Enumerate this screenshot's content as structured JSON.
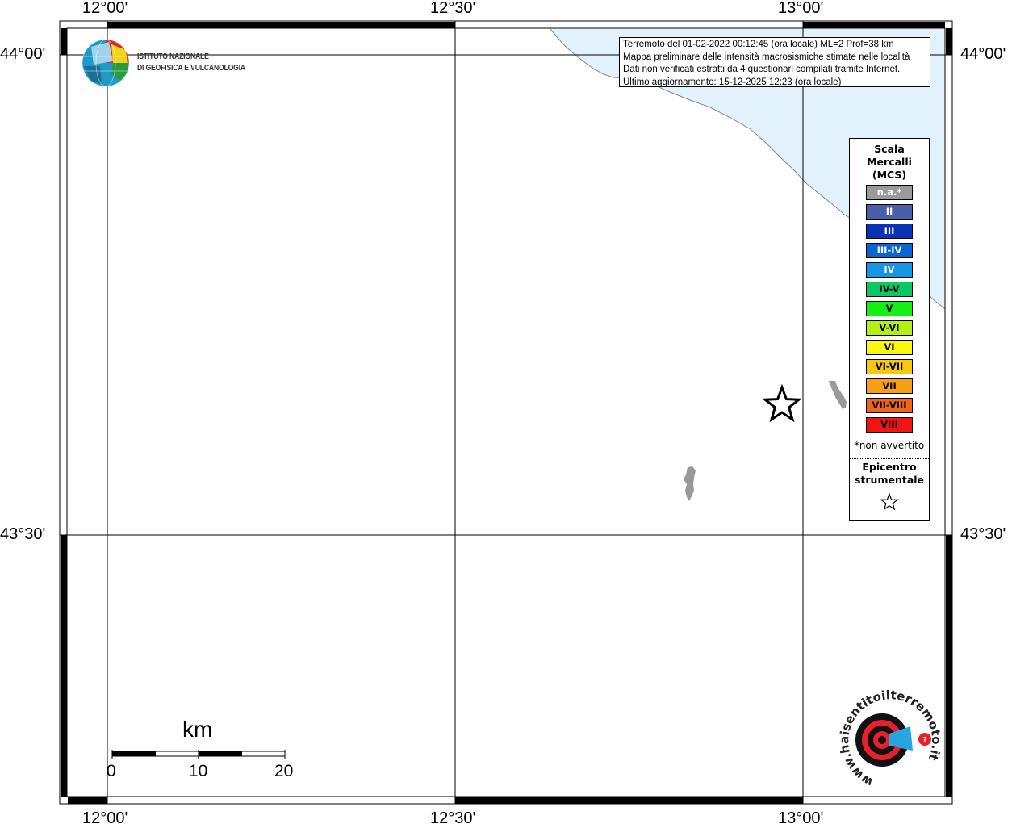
{
  "axes": {
    "top": [
      "12°00'",
      "12°30'",
      "13°00'"
    ],
    "bottom": [
      "12°00'",
      "12°30'",
      "13°00'"
    ],
    "left": [
      "44°00'",
      "43°30'"
    ],
    "right": [
      "44°00'",
      "43°30'"
    ]
  },
  "info": {
    "line1": "Terremoto del 01-02-2022 00:12:45 (ora locale) ML=2 Prof=38 km",
    "line2": "Mappa preliminare delle intensità macrosismiche stimate nelle località",
    "line3": "Dati non verificati estratti da 4 questionari compilati tramite Internet.",
    "line4": "Ultimo aggiornamento: 15-12-2025 12:23 (ora locale)"
  },
  "logo": {
    "line1": "ISTITUTO NAZIONALE",
    "line2": "DI GEOFISICA E VULCANOLOGIA"
  },
  "legend": {
    "title1": "Scala",
    "title2": "Mercalli",
    "title3": "(MCS)",
    "items": [
      {
        "label": "n.a.*",
        "color": "#9a9a9a"
      },
      {
        "label": "II",
        "color": "#4a5faa"
      },
      {
        "label": "III",
        "color": "#0a32b4"
      },
      {
        "label": "III-IV",
        "color": "#0a64d2"
      },
      {
        "label": "IV",
        "color": "#1496e6"
      },
      {
        "label": "IV-V",
        "color": "#0ac864"
      },
      {
        "label": "V",
        "color": "#14f014"
      },
      {
        "label": "V-VI",
        "color": "#b4f014"
      },
      {
        "label": "VI",
        "color": "#f8f810"
      },
      {
        "label": "VI-VII",
        "color": "#f8c810"
      },
      {
        "label": "VII",
        "color": "#f8a014"
      },
      {
        "label": "VII-VIII",
        "color": "#f06414"
      },
      {
        "label": "VIII",
        "color": "#f01414"
      }
    ],
    "note": "*non avvertito",
    "epi1": "Epicentro",
    "epi2": "strumentale"
  },
  "scalebar": {
    "unit": "km",
    "ticks": [
      "0",
      "10",
      "20"
    ]
  },
  "watermark": {
    "text": "www.haisentitoilterremoto.it"
  },
  "colors": {
    "sea": "#e2f2fc",
    "coast": "#888888",
    "lake": "#999999",
    "hsit_red": "#e8202a",
    "hsit_blue": "#2aa4e0"
  }
}
